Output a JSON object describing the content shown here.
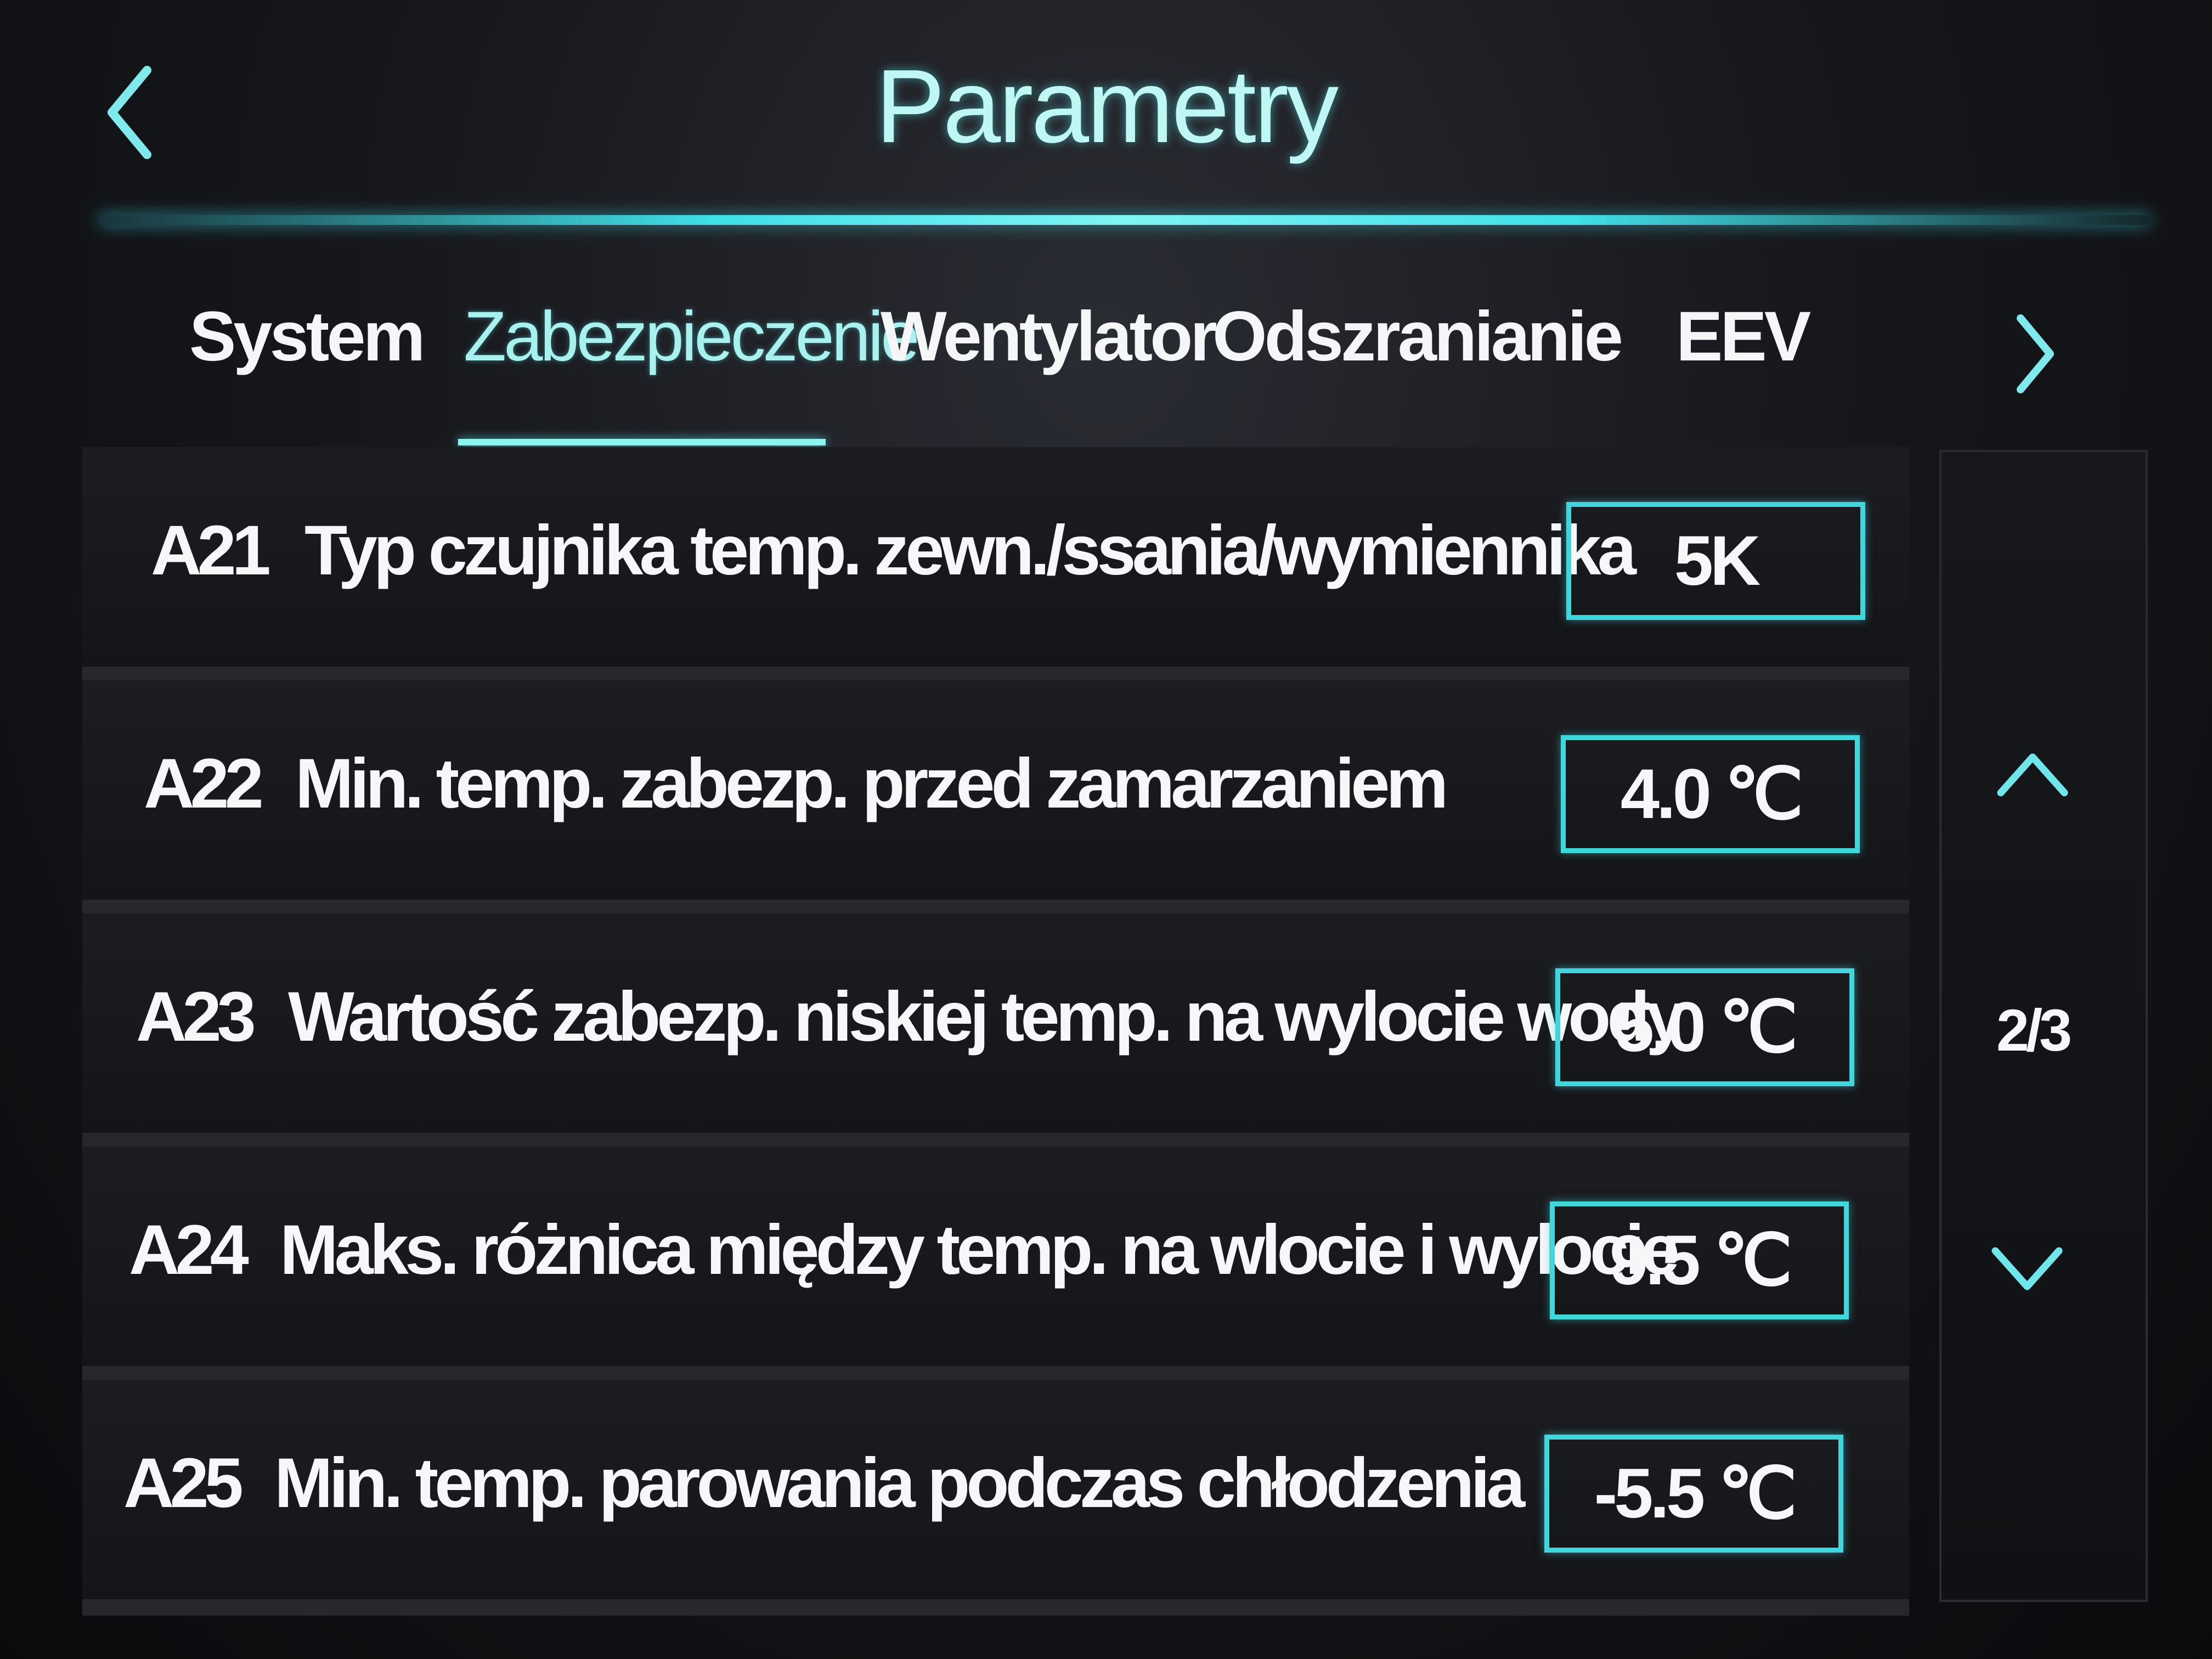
{
  "header": {
    "title": "Parametry"
  },
  "tabs": [
    {
      "label": "System"
    },
    {
      "label": "Zabezpieczenie",
      "active": true
    },
    {
      "label": "Wentylator"
    },
    {
      "label": "Odszranianie"
    },
    {
      "label": "EEV"
    }
  ],
  "parameters": [
    {
      "code": "A21",
      "label": "Typ czujnika temp. zewn./ssania/wymiennika",
      "value": "5K"
    },
    {
      "code": "A22",
      "label": "Min. temp. zabezp. przed zamarzaniem",
      "value": "4.0 ℃"
    },
    {
      "code": "A23",
      "label": "Wartość zabezp. niskiej temp. na wylocie wody",
      "value": "5.0 ℃"
    },
    {
      "code": "A24",
      "label": "Maks. różnica między temp. na wlocie i wylocie",
      "value": "9.5 ℃"
    },
    {
      "code": "A25",
      "label": "Min. temp. parowania podczas chłodzenia",
      "value": "-5.5 ℃"
    }
  ],
  "pagination": {
    "indicator": "2/3"
  },
  "icons": {
    "back": "chevron-left-icon",
    "next_tab": "chevron-right-icon",
    "scroll_up": "chevron-up-icon",
    "scroll_down": "chevron-down-icon"
  },
  "colors": {
    "accent": "#3fd6dc",
    "title": "#bff7f4",
    "text": "#f5f7f8"
  }
}
